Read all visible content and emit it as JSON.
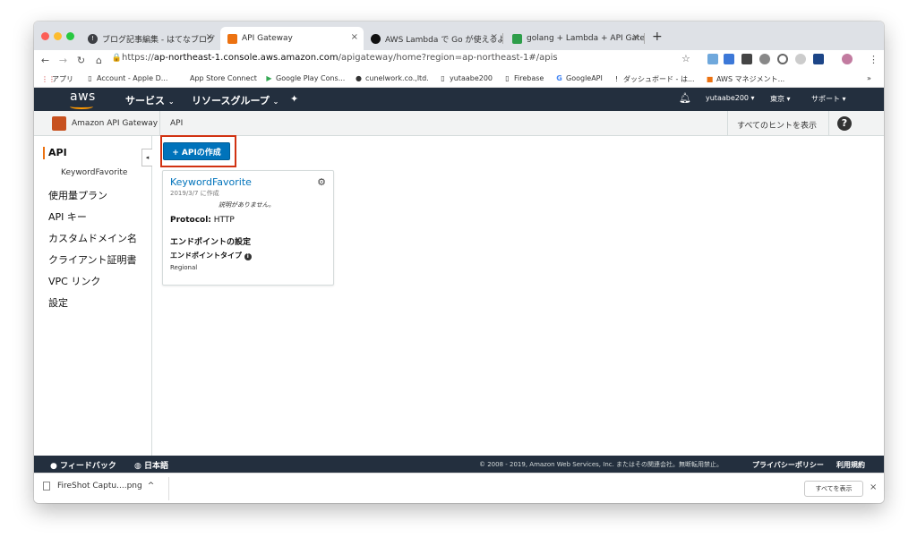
{
  "browser": {
    "tabs": [
      {
        "title": "ブログ記事編集 - はてなブログ",
        "close": "×",
        "favicon_color": "#3d3f44"
      },
      {
        "title": "API Gateway",
        "close": "×",
        "favicon_color": "#ec7211"
      },
      {
        "title": "AWS Lambda で Go が使えるよ！",
        "close": "×",
        "favicon_color": "#111111"
      },
      {
        "title": "golang + Lambda + API Gatew",
        "close": "×",
        "favicon_color": "#2e9e4a"
      }
    ],
    "new_tab": "+",
    "url_scheme": "https://",
    "url_host": "ap-northeast-1.console.aws.amazon.com",
    "url_path": "/apigateway/home?region=ap-northeast-1#/apis",
    "bookmarks": [
      "アプリ",
      "Account - Apple D...",
      "App Store Connect",
      "Google Play Cons...",
      "cunelwork.co.,ltd.",
      "yutaabe200",
      "Firebase",
      "GoogleAPI",
      "ダッシュボード - は...",
      "AWS マネジメント..."
    ],
    "bookmarks_more": "»"
  },
  "aws_header": {
    "logo": "aws",
    "services": "サービス",
    "resource_groups": "リソースグループ",
    "user": "yutaabe200",
    "region": "東京",
    "support": "サポート"
  },
  "subheader": {
    "service_name": "Amazon API Gateway",
    "breadcrumb": "API",
    "show_hints": "すべてのヒントを表示",
    "help": "?"
  },
  "sidebar": {
    "items": [
      {
        "label": "API"
      },
      {
        "label": "KeywordFavorite"
      },
      {
        "label": "使用量プラン"
      },
      {
        "label": "API キー"
      },
      {
        "label": "カスタムドメイン名"
      },
      {
        "label": "クライアント証明書"
      },
      {
        "label": "VPC リンク"
      },
      {
        "label": "設定"
      }
    ]
  },
  "main": {
    "create_button": "+ APIの作成",
    "card": {
      "title": "KeywordFavorite",
      "date": "2019/3/7 に作成",
      "description": "説明がありません。",
      "protocol_label": "Protocol:",
      "protocol_value": "HTTP",
      "endpoint_heading": "エンドポイントの設定",
      "endpoint_type_label": "エンドポイントタイプ",
      "endpoint_type_value": "Regional"
    }
  },
  "footer": {
    "feedback": "フィードバック",
    "language": "日本語",
    "copyright": "© 2008 - 2019, Amazon Web Services, Inc. またはその関連会社。無断転用禁止。",
    "privacy": "プライバシーポリシー",
    "terms": "利用規約"
  },
  "download": {
    "file": "FireShot Captu....png",
    "show_all": "すべてを表示",
    "close": "×"
  },
  "colors": {
    "aws_nav": "#232f3e",
    "aws_orange": "#ec7211",
    "primary_button": "#0073bb",
    "highlight_box": "#d13212"
  }
}
